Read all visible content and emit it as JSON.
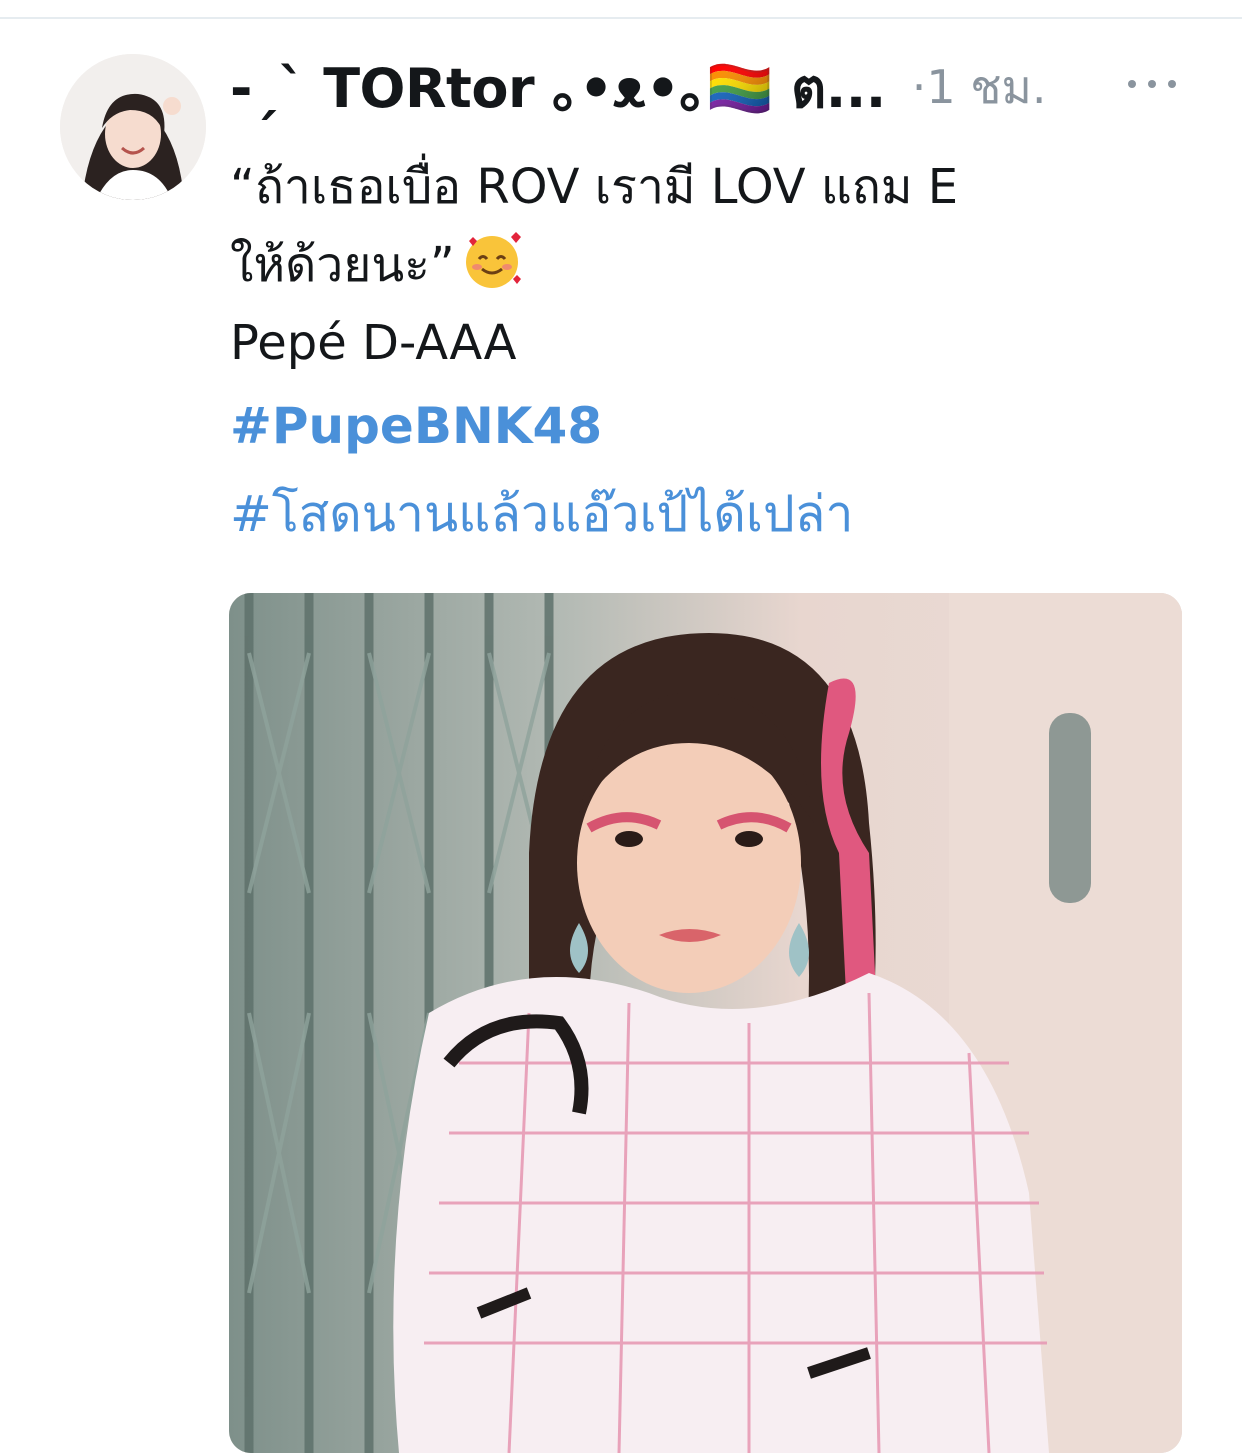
{
  "tweet": {
    "author": {
      "display_name": "-ˏˋ TORtor ｡•ᴥ•｡🏳️‍🌈 ต...",
      "avatar_icon": "profile-avatar"
    },
    "meta": "·1 ชม.",
    "more_icon": "more-dots-icon",
    "text_lines": [
      "“ถ้าเธอเบื่อ ROV เรามี LOV แถม E",
      "ให้ด้วยนะ”",
      "Pepé D-AAA"
    ],
    "hashtags": [
      "#PupeBNK48",
      "#โสดนานแล้วแอ๊วเป้ได้เปล่า"
    ],
    "media_icon": "photo-image"
  },
  "colors": {
    "text": "#14171a",
    "secondary": "#8a949e",
    "link": "#4a90d9",
    "divider": "#e6ecf0"
  }
}
